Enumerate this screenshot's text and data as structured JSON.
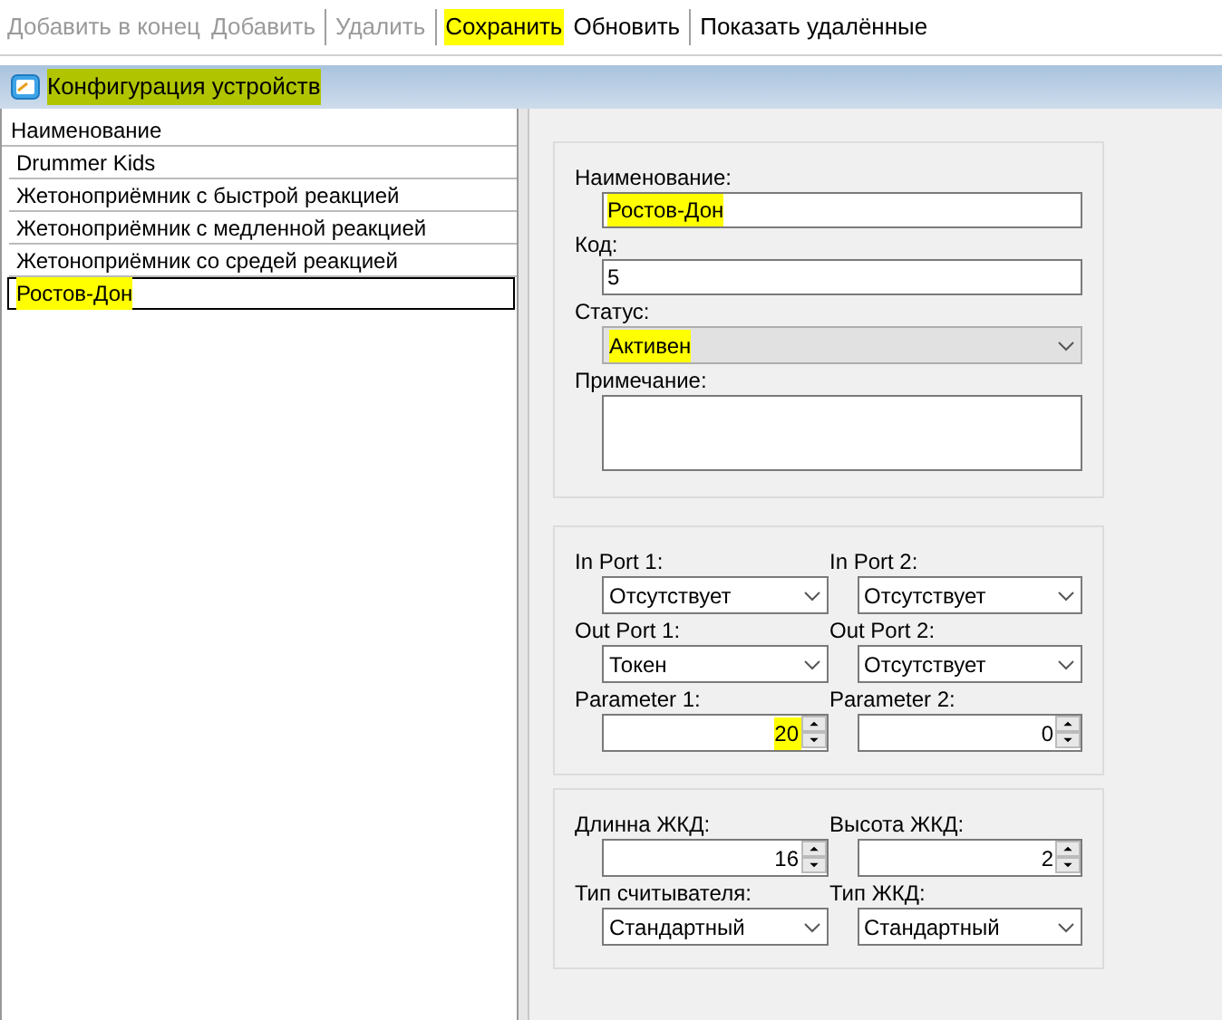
{
  "toolbar": [
    {
      "label": "Добавить в конец",
      "disabled": true,
      "highlighted": false,
      "separator_after": false
    },
    {
      "label": "Добавить",
      "disabled": true,
      "highlighted": false,
      "separator_after": true
    },
    {
      "label": "Удалить",
      "disabled": true,
      "highlighted": false,
      "separator_after": true
    },
    {
      "label": "Сохранить",
      "disabled": false,
      "highlighted": true,
      "separator_after": false
    },
    {
      "label": "Обновить",
      "disabled": false,
      "highlighted": false,
      "separator_after": true
    },
    {
      "label": "Показать удалённые",
      "disabled": false,
      "highlighted": false,
      "separator_after": false
    }
  ],
  "window": {
    "title": "Конфигурация устройств",
    "highlighted": true
  },
  "list": {
    "header": "Наименование",
    "rows": [
      {
        "label": "Drummer Kids",
        "selected": false,
        "highlighted": false
      },
      {
        "label": "Жетоноприёмник с быстрой реакцией",
        "selected": false,
        "highlighted": false
      },
      {
        "label": "Жетоноприёмник с медленной реакцией",
        "selected": false,
        "highlighted": false
      },
      {
        "label": "Жетоноприёмник со средей реакцией",
        "selected": false,
        "highlighted": false
      },
      {
        "label": "Ростов-Дон",
        "selected": true,
        "highlighted": true
      }
    ]
  },
  "form": [
    {
      "label": "Наименование:",
      "kind": "text",
      "value": "Ростов-Дон",
      "highlighted": true
    },
    {
      "label": "Код:",
      "kind": "text",
      "value": "5",
      "highlighted": false
    },
    {
      "label": "Статус:",
      "kind": "combo",
      "value": "Активен",
      "highlighted": true,
      "disabled": true
    },
    {
      "label": "Примечание:",
      "kind": "memo"
    }
  ],
  "ports": [
    {
      "label": "In Port 1:",
      "kind": "combo",
      "value": "Отсутствует",
      "highlighted": false,
      "disabled": false
    },
    {
      "label": "In Port 2:",
      "kind": "combo",
      "value": "Отсутствует",
      "highlighted": false,
      "disabled": false
    },
    {
      "label": "Out Port 1:",
      "kind": "combo",
      "value": "Токен",
      "highlighted": false,
      "disabled": false
    },
    {
      "label": "Out Port 2:",
      "kind": "combo",
      "value": "Отсутствует",
      "highlighted": false,
      "disabled": false
    },
    {
      "label": "Parameter 1:",
      "kind": "spin",
      "value": "20",
      "highlighted": true
    },
    {
      "label": "Parameter 2:",
      "kind": "spin",
      "value": "0",
      "highlighted": false
    }
  ],
  "display": [
    {
      "label": "Длинна ЖКД:",
      "kind": "spin",
      "value": "16",
      "highlighted": false
    },
    {
      "label": "Высота ЖКД:",
      "kind": "spin",
      "value": "2",
      "highlighted": false
    },
    {
      "label": "Тип считывателя:",
      "kind": "combo",
      "value": "Стандартный",
      "highlighted": false,
      "disabled": false
    },
    {
      "label": "Тип ЖКД:",
      "kind": "combo",
      "value": "Стандартный",
      "highlighted": false,
      "disabled": false
    }
  ]
}
